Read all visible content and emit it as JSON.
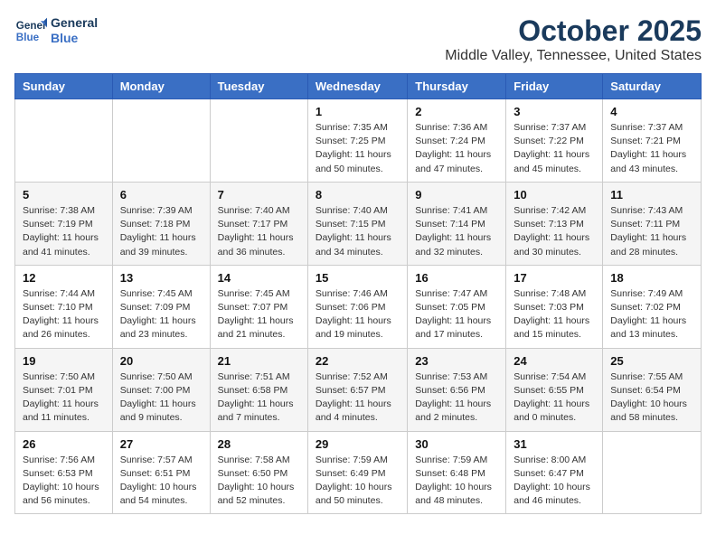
{
  "logo": {
    "line1": "General",
    "line2": "Blue"
  },
  "title": "October 2025",
  "location": "Middle Valley, Tennessee, United States",
  "headers": [
    "Sunday",
    "Monday",
    "Tuesday",
    "Wednesday",
    "Thursday",
    "Friday",
    "Saturday"
  ],
  "weeks": [
    [
      {
        "day": "",
        "info": ""
      },
      {
        "day": "",
        "info": ""
      },
      {
        "day": "",
        "info": ""
      },
      {
        "day": "1",
        "info": "Sunrise: 7:35 AM\nSunset: 7:25 PM\nDaylight: 11 hours\nand 50 minutes."
      },
      {
        "day": "2",
        "info": "Sunrise: 7:36 AM\nSunset: 7:24 PM\nDaylight: 11 hours\nand 47 minutes."
      },
      {
        "day": "3",
        "info": "Sunrise: 7:37 AM\nSunset: 7:22 PM\nDaylight: 11 hours\nand 45 minutes."
      },
      {
        "day": "4",
        "info": "Sunrise: 7:37 AM\nSunset: 7:21 PM\nDaylight: 11 hours\nand 43 minutes."
      }
    ],
    [
      {
        "day": "5",
        "info": "Sunrise: 7:38 AM\nSunset: 7:19 PM\nDaylight: 11 hours\nand 41 minutes."
      },
      {
        "day": "6",
        "info": "Sunrise: 7:39 AM\nSunset: 7:18 PM\nDaylight: 11 hours\nand 39 minutes."
      },
      {
        "day": "7",
        "info": "Sunrise: 7:40 AM\nSunset: 7:17 PM\nDaylight: 11 hours\nand 36 minutes."
      },
      {
        "day": "8",
        "info": "Sunrise: 7:40 AM\nSunset: 7:15 PM\nDaylight: 11 hours\nand 34 minutes."
      },
      {
        "day": "9",
        "info": "Sunrise: 7:41 AM\nSunset: 7:14 PM\nDaylight: 11 hours\nand 32 minutes."
      },
      {
        "day": "10",
        "info": "Sunrise: 7:42 AM\nSunset: 7:13 PM\nDaylight: 11 hours\nand 30 minutes."
      },
      {
        "day": "11",
        "info": "Sunrise: 7:43 AM\nSunset: 7:11 PM\nDaylight: 11 hours\nand 28 minutes."
      }
    ],
    [
      {
        "day": "12",
        "info": "Sunrise: 7:44 AM\nSunset: 7:10 PM\nDaylight: 11 hours\nand 26 minutes."
      },
      {
        "day": "13",
        "info": "Sunrise: 7:45 AM\nSunset: 7:09 PM\nDaylight: 11 hours\nand 23 minutes."
      },
      {
        "day": "14",
        "info": "Sunrise: 7:45 AM\nSunset: 7:07 PM\nDaylight: 11 hours\nand 21 minutes."
      },
      {
        "day": "15",
        "info": "Sunrise: 7:46 AM\nSunset: 7:06 PM\nDaylight: 11 hours\nand 19 minutes."
      },
      {
        "day": "16",
        "info": "Sunrise: 7:47 AM\nSunset: 7:05 PM\nDaylight: 11 hours\nand 17 minutes."
      },
      {
        "day": "17",
        "info": "Sunrise: 7:48 AM\nSunset: 7:03 PM\nDaylight: 11 hours\nand 15 minutes."
      },
      {
        "day": "18",
        "info": "Sunrise: 7:49 AM\nSunset: 7:02 PM\nDaylight: 11 hours\nand 13 minutes."
      }
    ],
    [
      {
        "day": "19",
        "info": "Sunrise: 7:50 AM\nSunset: 7:01 PM\nDaylight: 11 hours\nand 11 minutes."
      },
      {
        "day": "20",
        "info": "Sunrise: 7:50 AM\nSunset: 7:00 PM\nDaylight: 11 hours\nand 9 minutes."
      },
      {
        "day": "21",
        "info": "Sunrise: 7:51 AM\nSunset: 6:58 PM\nDaylight: 11 hours\nand 7 minutes."
      },
      {
        "day": "22",
        "info": "Sunrise: 7:52 AM\nSunset: 6:57 PM\nDaylight: 11 hours\nand 4 minutes."
      },
      {
        "day": "23",
        "info": "Sunrise: 7:53 AM\nSunset: 6:56 PM\nDaylight: 11 hours\nand 2 minutes."
      },
      {
        "day": "24",
        "info": "Sunrise: 7:54 AM\nSunset: 6:55 PM\nDaylight: 11 hours\nand 0 minutes."
      },
      {
        "day": "25",
        "info": "Sunrise: 7:55 AM\nSunset: 6:54 PM\nDaylight: 10 hours\nand 58 minutes."
      }
    ],
    [
      {
        "day": "26",
        "info": "Sunrise: 7:56 AM\nSunset: 6:53 PM\nDaylight: 10 hours\nand 56 minutes."
      },
      {
        "day": "27",
        "info": "Sunrise: 7:57 AM\nSunset: 6:51 PM\nDaylight: 10 hours\nand 54 minutes."
      },
      {
        "day": "28",
        "info": "Sunrise: 7:58 AM\nSunset: 6:50 PM\nDaylight: 10 hours\nand 52 minutes."
      },
      {
        "day": "29",
        "info": "Sunrise: 7:59 AM\nSunset: 6:49 PM\nDaylight: 10 hours\nand 50 minutes."
      },
      {
        "day": "30",
        "info": "Sunrise: 7:59 AM\nSunset: 6:48 PM\nDaylight: 10 hours\nand 48 minutes."
      },
      {
        "day": "31",
        "info": "Sunrise: 8:00 AM\nSunset: 6:47 PM\nDaylight: 10 hours\nand 46 minutes."
      },
      {
        "day": "",
        "info": ""
      }
    ]
  ]
}
